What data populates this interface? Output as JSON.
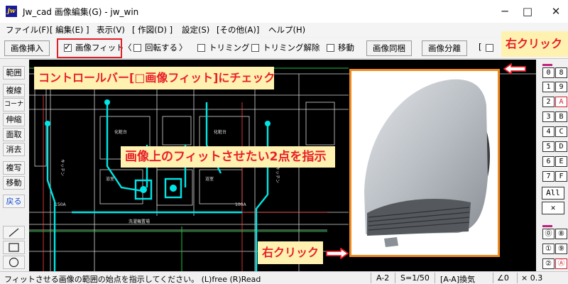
{
  "window": {
    "icon_text": "jw",
    "title": "Jw_cad 画像編集(G) - jw_win",
    "min_glyph": "─",
    "max_glyph": "□",
    "close_glyph": "✕"
  },
  "menu": [
    "ファイル(F)",
    "[ 編集(E) ]",
    "表示(V)",
    "[ 作図(D) ]",
    "設定(S)",
    "[その他(A)]",
    "ヘルプ(H)"
  ],
  "controlbar": {
    "insert_image": "画像挿入",
    "fit_image": "画像フィット",
    "fit_checked": true,
    "paren_open": "〈",
    "rotate": "回転する",
    "paren_close": "〉",
    "trimming": "トリミング",
    "trimming_release": "トリミング解除",
    "move": "移動",
    "sync": "画像同梱",
    "separate": "画像分離"
  },
  "left_tools": [
    "範囲",
    "複線",
    "コーナー",
    "伸縮",
    "面取",
    "消去",
    "複写",
    "移動",
    "戻る"
  ],
  "left_shape_tools": [
    "line-tool-icon",
    "rectangle-tool-icon",
    "circle-tool-icon"
  ],
  "right_tools": {
    "col_a": [
      "0",
      "1",
      "2",
      "3",
      "4",
      "5",
      "6",
      "7"
    ],
    "col_b": [
      "8",
      "9",
      "A",
      "B",
      "C",
      "D",
      "E",
      "F"
    ],
    "all": "All",
    "cross": "✕",
    "lower_a": [
      "⓪",
      "①",
      "②"
    ],
    "lower_b": [
      "⑧",
      "⑨",
      "Ⓐ"
    ]
  },
  "status": {
    "message": "フィットさせる画像の範囲の始点を指示してください。 (L)free (R)Read",
    "paper": "A-2",
    "scale": "S=1/50",
    "layer": "[A-A]換気",
    "angle": "∠0",
    "factor": "× 0.3"
  },
  "annotations": {
    "check_note": "コントロールバー[□画像フィット]にチェック",
    "points_note": "画像上のフィットさせたい2点を指示",
    "right_click_top": "右クリック",
    "right_click_bottom": "右クリック"
  },
  "colors": {
    "annotation_bg": "#fff2b0",
    "annotation_red": "#e8202a",
    "annotation_blue": "#1a40d0",
    "canvas_bg": "#000000",
    "drawing_cyan": "#00e6e6",
    "drawing_green": "#20c040",
    "photo_frame": "#f08a20"
  },
  "canvas_labels": [
    "キッチン",
    "洗濯機置場",
    "化粧台",
    "浴室",
    "150A",
    "100A"
  ]
}
